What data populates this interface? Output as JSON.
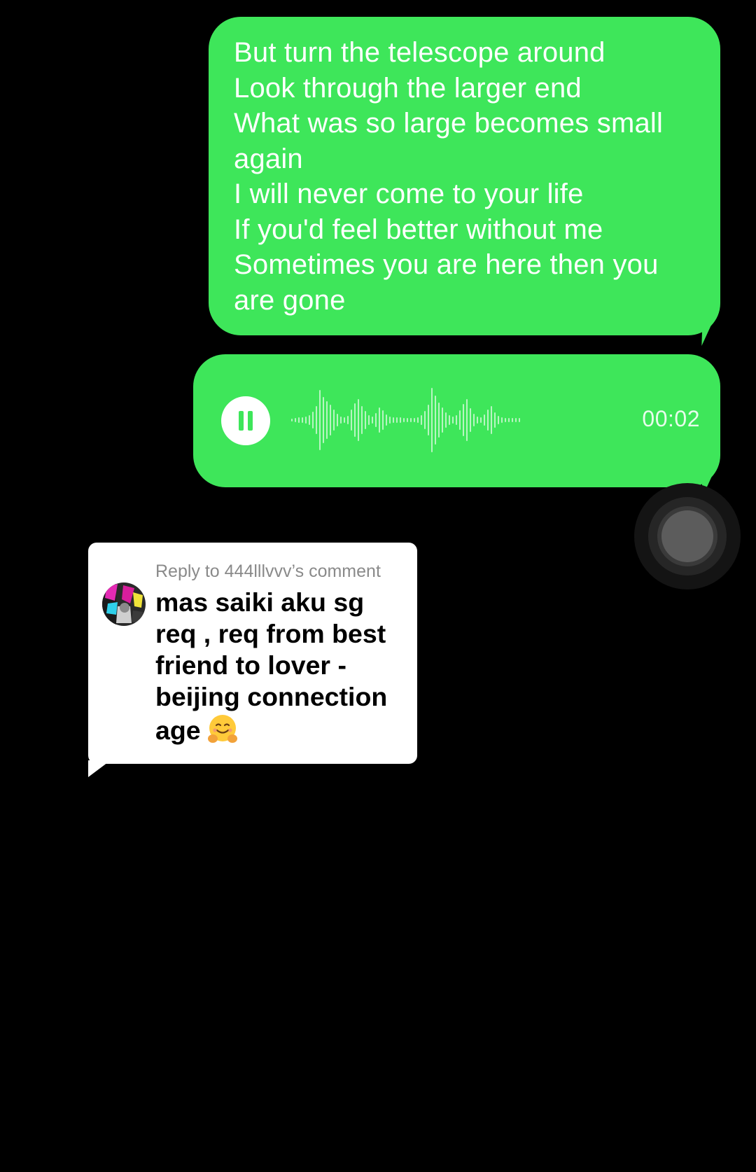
{
  "messages": {
    "text_bubble": {
      "lines": [
        "But turn the telescope around",
        "Look through the larger end",
        "What was so large becomes small",
        "again",
        "I will never come to your life",
        "If you'd feel better without me",
        "Sometimes you are here then you",
        "are gone"
      ]
    },
    "voice_bubble": {
      "state_icon": "pause-icon",
      "duration": "00:02"
    }
  },
  "reply_card": {
    "header": "Reply to 444lllvvv’s comment",
    "body_lines": [
      "mas saiki aku sg",
      "req , req from best",
      "friend to lover -",
      "beijing connection",
      "age"
    ],
    "emoji": "hugging-face-emoji"
  },
  "colors": {
    "background": "#000000",
    "bubble_green": "#3ee65a",
    "text_white": "#ffffff",
    "reply_card_bg": "#ffffff",
    "reply_header_gray": "#8a8a8a"
  }
}
